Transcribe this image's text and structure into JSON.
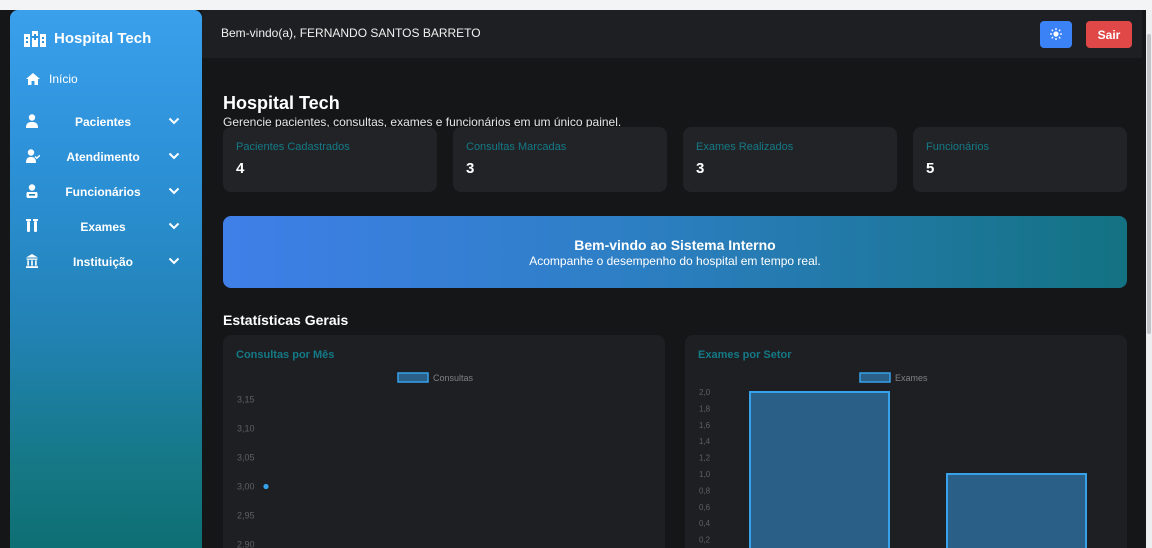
{
  "app": {
    "brand": "Hospital Tech"
  },
  "sidebar": {
    "home_label": "Início",
    "items": [
      {
        "label": "Pacientes",
        "icon": "user-icon"
      },
      {
        "label": "Atendimento",
        "icon": "user-check-icon"
      },
      {
        "label": "Funcionários",
        "icon": "id-badge-icon"
      },
      {
        "label": "Exames",
        "icon": "vials-icon"
      },
      {
        "label": "Instituição",
        "icon": "bank-icon"
      }
    ]
  },
  "topbar": {
    "welcome": "Bem-vindo(a), FERNANDO SANTOS BARRETO",
    "theme_icon": "sun-icon",
    "exit_label": "Sair"
  },
  "dashboard": {
    "title": "Hospital Tech",
    "subtitle": "Gerencie pacientes, consultas, exames e funcionários em um único painel.",
    "stats": [
      {
        "label": "Pacientes Cadastrados",
        "value": "4"
      },
      {
        "label": "Consultas Marcadas",
        "value": "3"
      },
      {
        "label": "Exames Realizados",
        "value": "3"
      },
      {
        "label": "Funcionários",
        "value": "5"
      }
    ],
    "banner": {
      "title": "Bem-vindo ao Sistema Interno",
      "subtitle": "Acompanhe o desempenho do hospital em tempo real."
    },
    "section_title": "Estatísticas Gerais"
  },
  "colors": {
    "accent": "#147a87",
    "primary": "#3b82f6",
    "danger": "#e04848",
    "bar_fill": "#2a5f87",
    "bar_stroke": "#36a2eb"
  },
  "chart_data": [
    {
      "type": "line",
      "title": "Consultas por Mês",
      "legend": "top-center",
      "series": [
        {
          "name": "Consultas",
          "values": [
            3.0
          ]
        }
      ],
      "x": [],
      "ylim": [
        2.88,
        3.17
      ],
      "y_ticks": [
        "3,15",
        "3,10",
        "3,05",
        "3,00",
        "2,95",
        "2,90"
      ],
      "y_tick_values": [
        3.15,
        3.1,
        3.05,
        3.0,
        2.95,
        2.9
      ],
      "grid": false
    },
    {
      "type": "bar",
      "title": "Exames por Setor",
      "legend": "top-center",
      "series": [
        {
          "name": "Exames",
          "values": [
            2,
            1
          ]
        }
      ],
      "categories": [],
      "ylim": [
        0,
        2.0
      ],
      "y_ticks": [
        "2,0",
        "1,8",
        "1,6",
        "1,4",
        "1,2",
        "1,0",
        "0,8",
        "0,6",
        "0,4",
        "0,2"
      ],
      "y_tick_values": [
        2.0,
        1.8,
        1.6,
        1.4,
        1.2,
        1.0,
        0.8,
        0.6,
        0.4,
        0.2
      ],
      "grid": false
    }
  ]
}
